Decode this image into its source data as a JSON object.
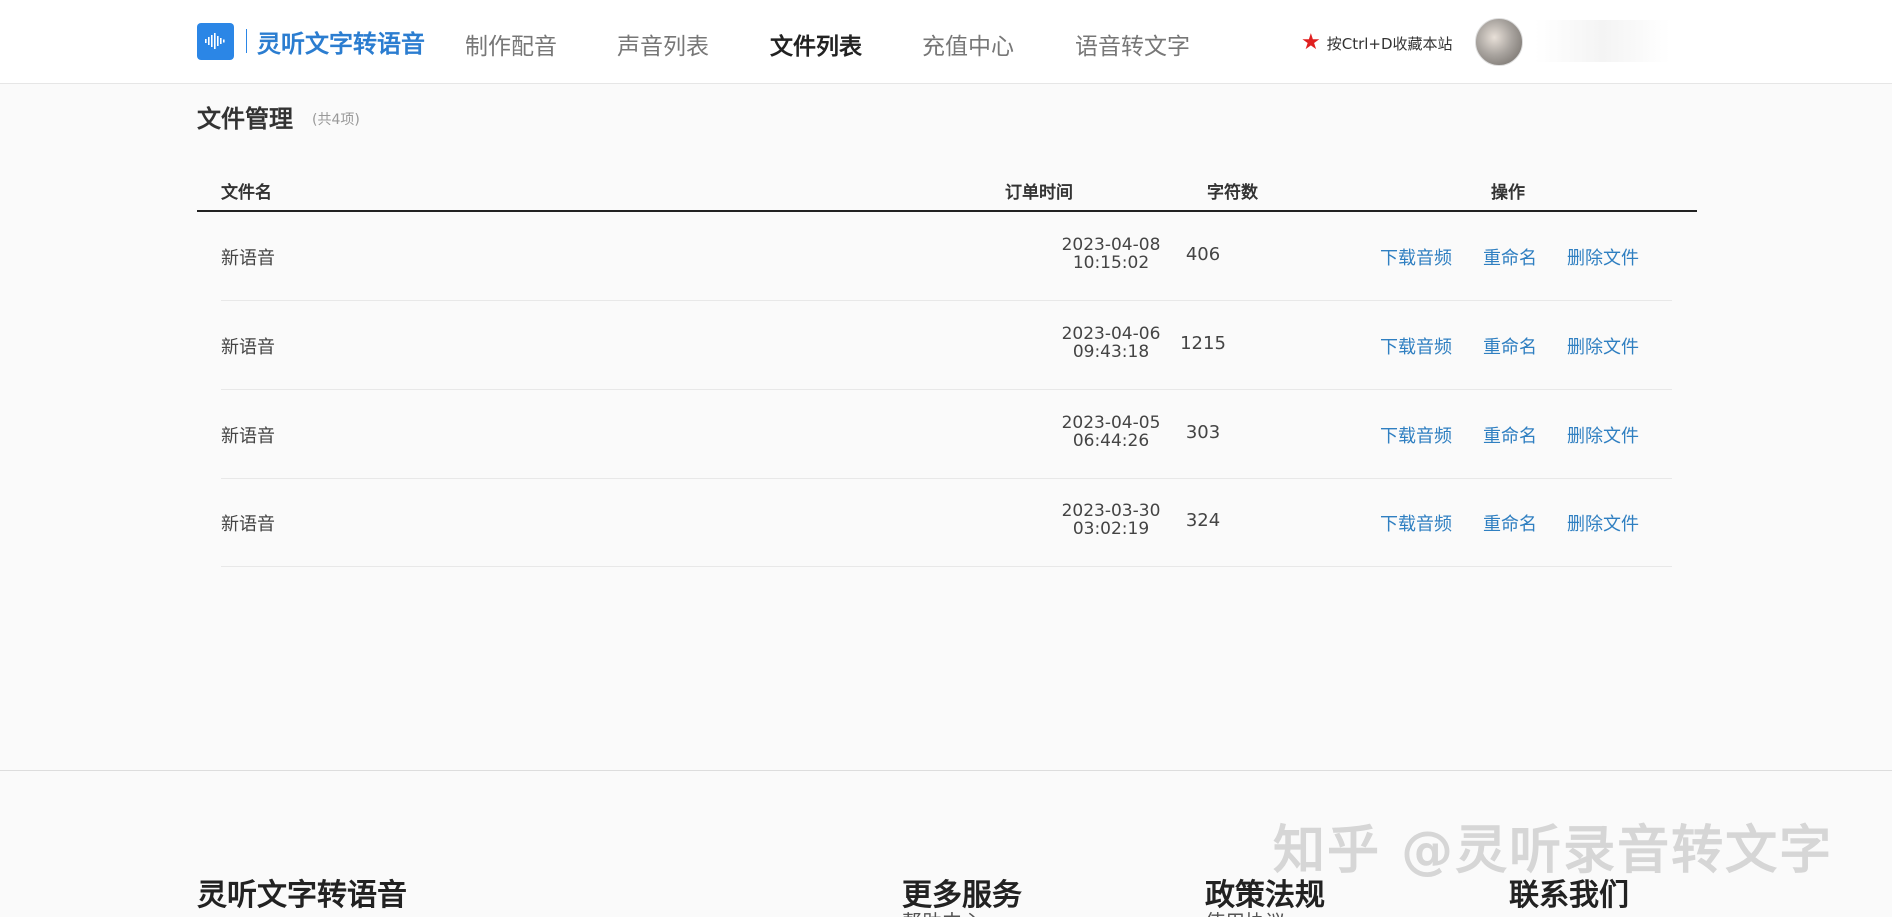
{
  "header": {
    "logo_text": "灵听文字转语音",
    "nav": [
      {
        "label": "制作配音"
      },
      {
        "label": "声音列表"
      },
      {
        "label": "文件列表"
      },
      {
        "label": "充值中心"
      },
      {
        "label": "语音转文字"
      }
    ],
    "active_nav": "文件列表",
    "bookmark_text": "按Ctrl+D收藏本站"
  },
  "main": {
    "title": "文件管理",
    "count": "(共4项)",
    "columns": {
      "name": "文件名",
      "time": "订单时间",
      "chars": "字符数",
      "actions": "操作"
    },
    "rows": [
      {
        "name": "新语音",
        "date": "2023-04-08",
        "time": "10:15:02",
        "chars": "406"
      },
      {
        "name": "新语音",
        "date": "2023-04-06",
        "time": "09:43:18",
        "chars": "1215"
      },
      {
        "name": "新语音",
        "date": "2023-04-05",
        "time": "06:44:26",
        "chars": "303"
      },
      {
        "name": "新语音",
        "date": "2023-03-30",
        "time": "03:02:19",
        "chars": "324"
      }
    ],
    "actions": {
      "download": "下载音频",
      "rename": "重命名",
      "delete": "删除文件"
    }
  },
  "footer": {
    "brand": "灵听文字转语音",
    "columns": [
      "更多服务",
      "政策法规",
      "联系我们"
    ],
    "sub_items": [
      "帮助中心",
      "使用协议"
    ]
  },
  "watermark": "知乎 @灵听录音转文字",
  "colors": {
    "accent": "#2b7dd0",
    "link": "#2f7fc1",
    "star": "#e02020"
  },
  "icons": {
    "logo": "sound-wave-icon",
    "bookmark": "star-icon"
  }
}
